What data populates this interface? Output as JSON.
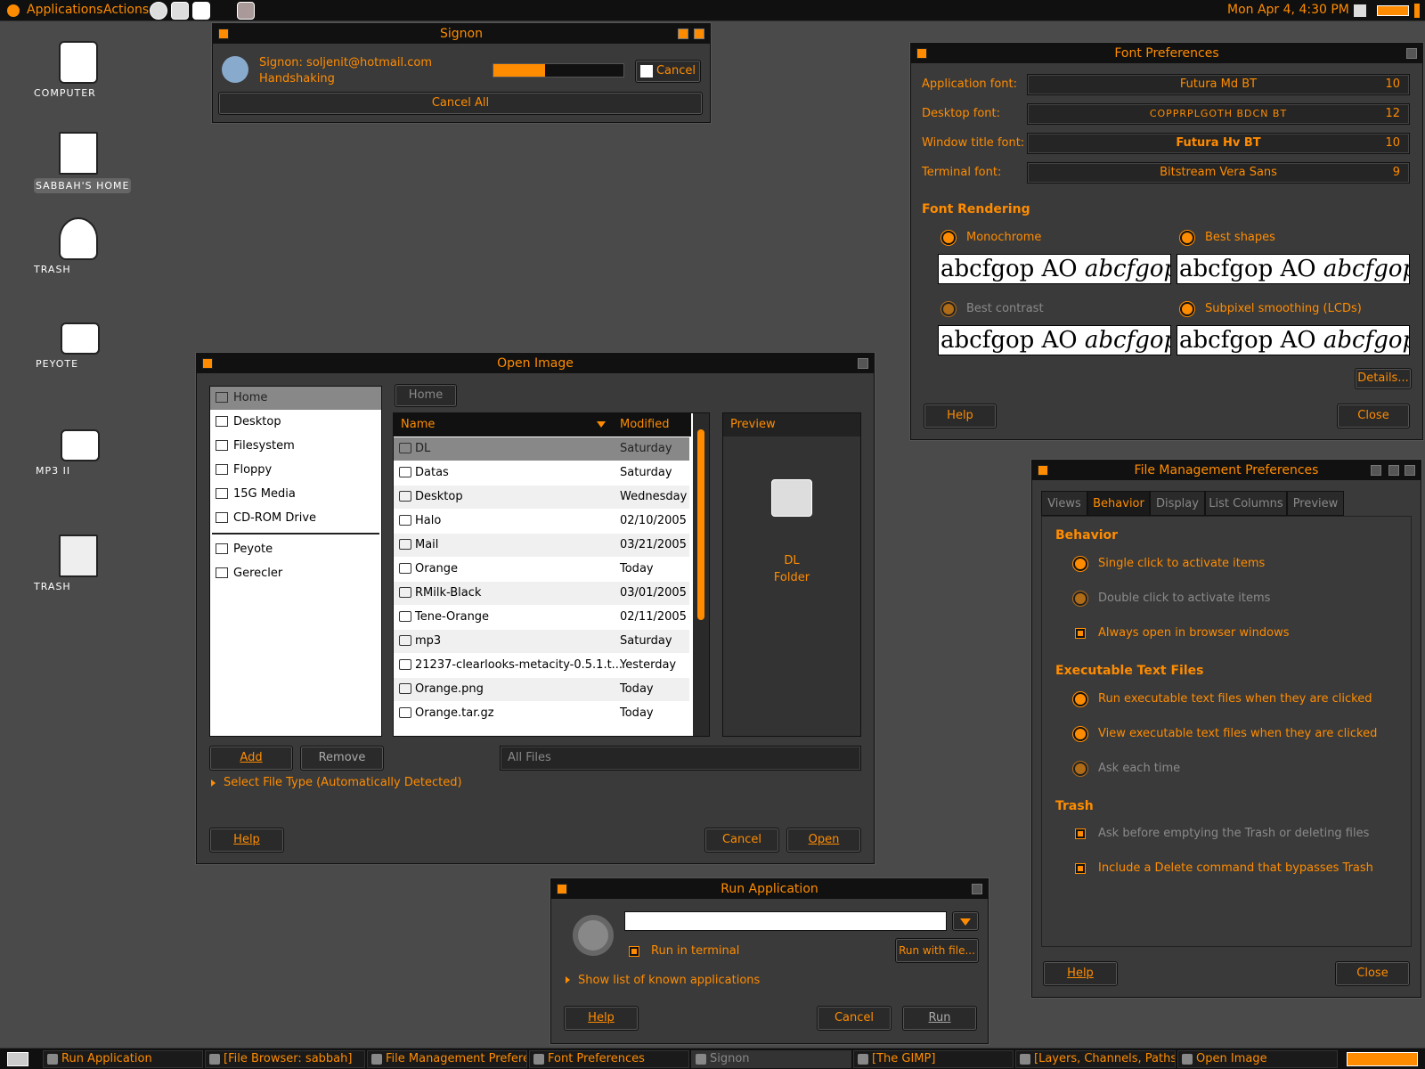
{
  "top_panel": {
    "applications": "Applications",
    "actions": "Actions",
    "clock": "Mon Apr  4,  4:30 PM"
  },
  "desktop": {
    "icons": [
      {
        "label": "Computer"
      },
      {
        "label": "sabbah's Home"
      },
      {
        "label": "Trash"
      },
      {
        "label": "Peyote"
      },
      {
        "label": "MP3 II"
      },
      {
        "label": "Trash"
      }
    ]
  },
  "signon": {
    "title": "Signon",
    "account": "Signon: soljenit@hotmail.com",
    "status": "Handshaking",
    "progress": 0.4,
    "cancel": "Cancel",
    "cancel_all": "Cancel All"
  },
  "font_prefs": {
    "title": "Font Preferences",
    "rows": [
      {
        "label": "Application font:",
        "font": "Futura Md BT",
        "size": "10"
      },
      {
        "label": "Desktop font:",
        "font": "CopprplGoth BdCn BT",
        "size": "12"
      },
      {
        "label": "Window title font:",
        "font": "Futura Hv BT",
        "size": "10"
      },
      {
        "label": "Terminal font:",
        "font": "Bitstream Vera Sans",
        "size": "9"
      }
    ],
    "rendering_heading": "Font Rendering",
    "options": [
      "Monochrome",
      "Best shapes",
      "Best contrast",
      "Subpixel smoothing (LCDs)"
    ],
    "sample_plain": "abcfgop AO ",
    "sample_italic": "abcfgop",
    "details": "Details...",
    "help": "Help",
    "close": "Close"
  },
  "open_image": {
    "title": "Open Image",
    "sidebar": [
      "Home",
      "Desktop",
      "Filesystem",
      "Floppy",
      "15G Media",
      "CD-ROM Drive",
      "Peyote",
      "Gerecler"
    ],
    "path_button": "Home",
    "col_name": "Name",
    "col_modified": "Modified",
    "files": [
      {
        "name": "DL",
        "modified": "Saturday"
      },
      {
        "name": "Datas",
        "modified": "Saturday"
      },
      {
        "name": "Desktop",
        "modified": "Wednesday"
      },
      {
        "name": "Halo",
        "modified": "02/10/2005"
      },
      {
        "name": "Mail",
        "modified": "03/21/2005"
      },
      {
        "name": "Orange",
        "modified": "Today"
      },
      {
        "name": "RMilk-Black",
        "modified": "03/01/2005"
      },
      {
        "name": "Tene-Orange",
        "modified": "02/11/2005"
      },
      {
        "name": "mp3",
        "modified": "Saturday"
      },
      {
        "name": "21237-clearlooks-metacity-0.5.1.t...",
        "modified": "Yesterday"
      },
      {
        "name": "Orange.png",
        "modified": "Today"
      },
      {
        "name": "Orange.tar.gz",
        "modified": "Today"
      }
    ],
    "preview_label": "Preview",
    "preview_name": "DL",
    "preview_type": "Folder",
    "add": "Add",
    "remove": "Remove",
    "filter": "All Files",
    "file_type": "Select File Type (Automatically Detected)",
    "help": "Help",
    "cancel": "Cancel",
    "open": "Open"
  },
  "file_mgmt": {
    "title": "File Management Preferences",
    "tabs": [
      "Views",
      "Behavior",
      "Display",
      "List Columns",
      "Preview"
    ],
    "behavior_heading": "Behavior",
    "behavior_opts": [
      "Single click to activate items",
      "Double click to activate items",
      "Always open in browser windows"
    ],
    "exec_heading": "Executable Text Files",
    "exec_opts": [
      "Run executable text files when they are clicked",
      "View executable text files when they are clicked",
      "Ask each time"
    ],
    "trash_heading": "Trash",
    "trash_opts": [
      "Ask before emptying the Trash or deleting files",
      "Include a Delete command that bypasses Trash"
    ],
    "help": "Help",
    "close": "Close"
  },
  "run_app": {
    "title": "Run Application",
    "command": "",
    "run_in_terminal": "Run in terminal",
    "run_with_file": "Run with file...",
    "show_list": "Show list of known applications",
    "help": "Help",
    "cancel": "Cancel",
    "run": "Run"
  },
  "taskbar": [
    "Run Application",
    "[File Browser: sabbah]",
    "File Management Preferen",
    "Font Preferences",
    "Signon",
    "[The GIMP]",
    "[Layers, Channels, Paths,",
    "Open Image"
  ],
  "colors": {
    "accent": "#ff8c00",
    "bg": "#4a4a4a",
    "window": "#3a3a3a"
  }
}
